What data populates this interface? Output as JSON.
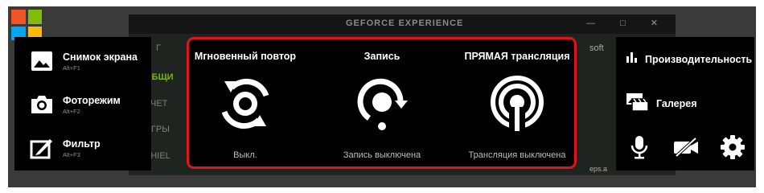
{
  "background": {
    "window_title": "GEFORCE EXPERIENCE",
    "window_controls": "—  □  ✕",
    "side_items": [
      "ОБЩИ",
      "УЧЕТ",
      "ИГРЫ",
      "SHIEL"
    ],
    "side_home_label": "Г",
    "right_snippet": "soft",
    "right_snippet_2": "eps.a",
    "logo_colors": [
      "#f35325",
      "#81bc06",
      "#05a6f0",
      "#ffba08"
    ]
  },
  "left_panel": {
    "items": [
      {
        "label": "Снимок экрана",
        "shortcut": "Alt+F1",
        "icon": "image-icon"
      },
      {
        "label": "Фоторежим",
        "shortcut": "Alt+F2",
        "icon": "camera-icon"
      },
      {
        "label": "Фильтр",
        "shortcut": "Alt+F3",
        "icon": "filter-icon"
      }
    ]
  },
  "center_panel": {
    "highlight_color": "#e0141c",
    "features": [
      {
        "title": "Мгновенный повтор",
        "status": "Выкл.",
        "icon": "instant-replay-icon"
      },
      {
        "title": "Запись",
        "status": "Запись выключена",
        "icon": "record-icon"
      },
      {
        "title": "ПРЯМАЯ трансляция",
        "status": "Трансляция выключена",
        "icon": "broadcast-icon"
      }
    ]
  },
  "right_panel": {
    "items": [
      {
        "label": "Производительность",
        "icon": "bar-chart-icon"
      },
      {
        "label": "Галерея",
        "icon": "gallery-icon"
      }
    ],
    "bottom_icons": [
      "microphone-icon",
      "camera-off-icon",
      "gear-icon"
    ]
  }
}
